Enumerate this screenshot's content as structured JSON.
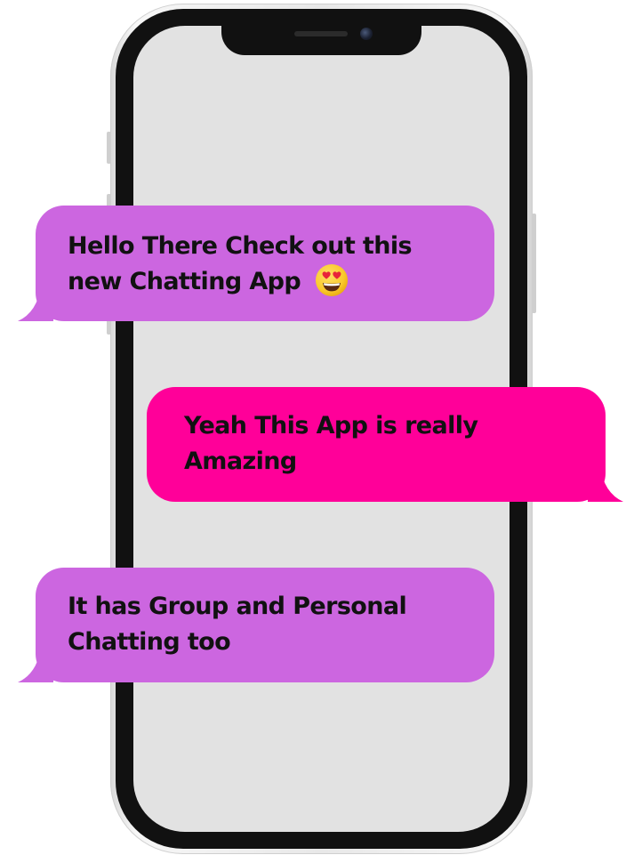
{
  "colors": {
    "incoming_bubble": "#cc66e0",
    "outgoing_bubble": "#ff0099",
    "screen": "#e2e2e2",
    "bezel": "#111111",
    "text": "#111111"
  },
  "messages": [
    {
      "direction": "incoming",
      "line1": "Hello There Check out this",
      "line2": "new Chatting App",
      "emoji": "heart-eyes-emoji"
    },
    {
      "direction": "outgoing",
      "line1": "Yeah This App is really",
      "line2": "Amazing"
    },
    {
      "direction": "incoming",
      "line1": "It has Group and Personal",
      "line2": "Chatting too"
    }
  ]
}
